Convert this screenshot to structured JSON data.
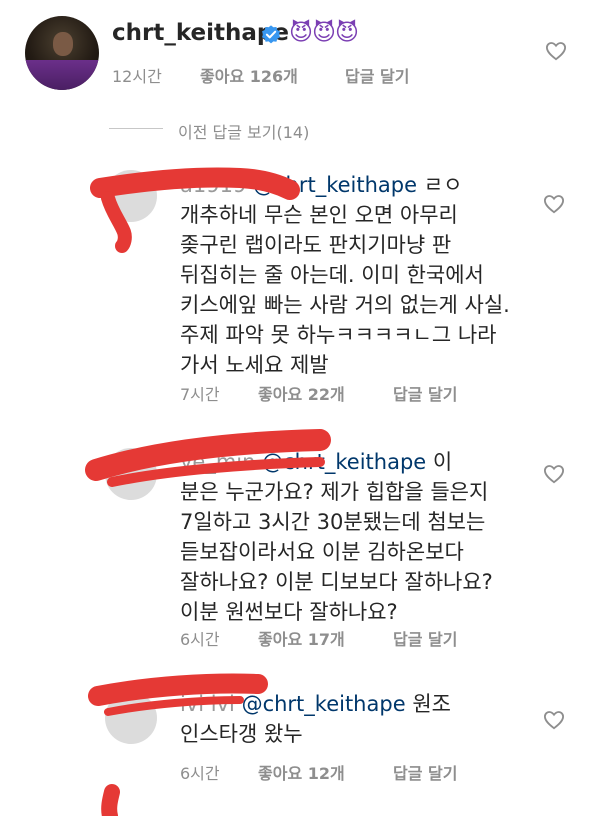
{
  "top_comment": {
    "username": "chrt_keithape",
    "emojis": "😈😈😈",
    "time": "12시간",
    "likes": "좋아요 126개",
    "reply": "답글 달기"
  },
  "view_prev": "이전 답글 보기(14)",
  "replies": [
    {
      "partial_name": "a1919",
      "mention": "@chrt_keithape",
      "lines": [
        "ㄹㅇ",
        "개추하네 무슨 본인 오면 아무리",
        "좆구린 랩이라도 판치기마냥 판",
        "뒤집히는 줄 아는데. 이미 한국에서",
        "키스에잎 빠는 사람 거의 없는게 사실.",
        "주제 파악 못 하누ㅋㅋㅋㅋㄴ그 나라",
        "가서 노세요 제발"
      ],
      "time": "7시간",
      "likes": "좋아요 22개",
      "reply": "답글 달기"
    },
    {
      "partial_name": "ye_min",
      "mention": "@chrt_keithape",
      "lines": [
        "이",
        "분은 누군가요? 제가 힙합을 들은지",
        "7일하고 3시간 30분됐는데 첨보는",
        "듣보잡이라서요 이분 김하온보다",
        "잘하나요? 이분 디보보다 잘하나요?",
        "이분 원썬보다 잘하나요?"
      ],
      "time": "6시간",
      "likes": "좋아요 17개",
      "reply": "답글 달기"
    },
    {
      "partial_name": "ivi ivi",
      "mention": "@chrt_keithape",
      "lines": [
        "원조",
        "인스타갱 왔누"
      ],
      "time": "6시간",
      "likes": "좋아요 12개",
      "reply": "답글 달기"
    }
  ],
  "colors": {
    "text": "#262626",
    "secondary": "#8e8e8e",
    "mention": "#00376b",
    "verified": "#3897f0",
    "scribble": "#e53935"
  },
  "icons": [
    "verified-badge-icon",
    "heart-icon"
  ]
}
